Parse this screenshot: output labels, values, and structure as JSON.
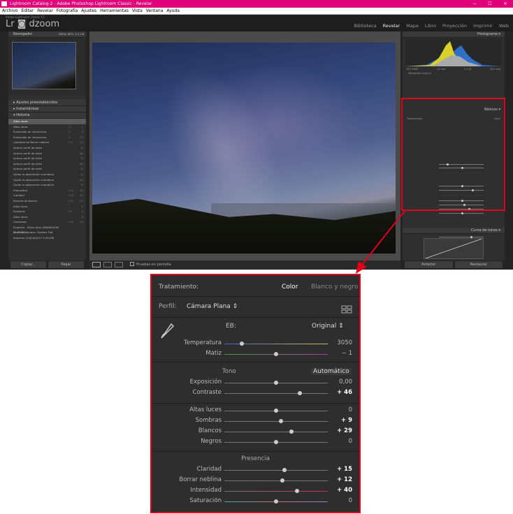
{
  "window": {
    "title": "Lightroom Catalog-2 - Adobe Photoshop Lightroom Classic - Revelar",
    "controls": [
      "—",
      "☐",
      "✕"
    ]
  },
  "menu": [
    "Archivo",
    "Editar",
    "Revelar",
    "Fotografía",
    "Ajustes",
    "Herramientas",
    "Vista",
    "Ventana",
    "Ayuda"
  ],
  "identity": {
    "sub": "Adobe Lightroom Classic CC",
    "logo": "Lr ◙ dzoom"
  },
  "modules": [
    "Biblioteca",
    "Revelar",
    "Mapa",
    "Libro",
    "Proyección",
    "Imprimir",
    "Web"
  ],
  "activeModule": "Revelar",
  "left": {
    "navigator": "Navegador",
    "nav_modes": "ENCAJ.  RELL.  1:1  1:8",
    "presets": "Ajustes preestablecidos",
    "snapshots": "Instantáneas",
    "history": "Historia",
    "history_items": [
      {
        "label": "Altas luces",
        "a": "-7",
        "b": "0",
        "sel": true
      },
      {
        "label": "Altas luces",
        "a": "-7",
        "b": "7"
      },
      {
        "label": "Suavizado de luminancia",
        "a": "-1",
        "b": "0"
      },
      {
        "label": "Suavizado de luminancia",
        "a": "-1",
        "b": "10"
      },
      {
        "label": "Cantidad de Borrar neblina",
        "a": "+11",
        "b": "12"
      },
      {
        "label": "Activar perfil de lente",
        "a": "",
        "b": "Sí"
      },
      {
        "label": "Activar perfil de lente",
        "a": "",
        "b": "No"
      },
      {
        "label": "Activar perfil de lente",
        "a": "",
        "b": "Sí"
      },
      {
        "label": "Activar perfil de lente",
        "a": "",
        "b": "No"
      },
      {
        "label": "Activar perfil de lente",
        "a": "",
        "b": "Sí"
      },
      {
        "label": "Quitar la aberración cromática",
        "a": "",
        "b": "Sí"
      },
      {
        "label": "Quitar la aberración cromática",
        "a": "",
        "b": "No"
      },
      {
        "label": "Quitar la aberración cromática",
        "a": "",
        "b": "Sí"
      },
      {
        "label": "Intensidad",
        "a": "+40",
        "b": "40"
      },
      {
        "label": "Claridad",
        "a": "+15",
        "b": "15"
      },
      {
        "label": "Recorte de blanco",
        "a": "+29",
        "b": "29"
      },
      {
        "label": "Altas luces",
        "a": "",
        "b": "0"
      },
      {
        "label": "Sombras",
        "a": "+9",
        "b": "9"
      },
      {
        "label": "Altas luces",
        "a": "",
        "b": "0"
      },
      {
        "label": "Contraste",
        "a": "+46",
        "b": "46"
      },
      {
        "label": "Exportar - Disco duro (28/06/2018 11:03:57)",
        "a": "",
        "b": ""
      },
      {
        "label": "Perfil de cámara: Camera Flat",
        "a": "",
        "b": ""
      },
      {
        "label": "Importar (24/04/2017 0:45:06)",
        "a": "",
        "b": ""
      }
    ],
    "copy": "Copiar...",
    "paste": "Pegar"
  },
  "toolbar": {
    "soft_proof": "Pruebas en pantalla"
  },
  "right": {
    "histogram": "Histograma",
    "exif": [
      "ISO 6400",
      "14 mm",
      "f / 2,8",
      "30,0 seg"
    ],
    "original_photo": "Fotografía original",
    "basics": "Básicos",
    "curve": "Curva de tonos",
    "previous": "Anterior",
    "reset": "Restaurar"
  },
  "basic": {
    "treatment": "Tratamiento:",
    "color": "Color",
    "bw": "Blanco y negro",
    "profile_label": "Perfil:",
    "profile": "Cámara Plana ⇕",
    "wb_label": "EB:",
    "wb": "Original ⇕",
    "tone": "Tono",
    "auto": "Automático",
    "presence": "Presencia",
    "sliders": [
      {
        "label": "Temperatura",
        "value": "3050",
        "pos": 0.17,
        "track": "temp",
        "group": "wb"
      },
      {
        "label": "Matiz",
        "value": "− 1",
        "pos": 0.5,
        "track": "tint",
        "group": "wb"
      },
      {
        "label": "Exposición",
        "value": "0,00",
        "pos": 0.5,
        "track": "",
        "group": "tone"
      },
      {
        "label": "Contraste",
        "value": "+ 46",
        "pos": 0.73,
        "track": "",
        "group": "tone",
        "bold": true
      },
      {
        "label": "Altas luces",
        "value": "0",
        "pos": 0.5,
        "track": "",
        "group": "tone2"
      },
      {
        "label": "Sombras",
        "value": "+ 9",
        "pos": 0.55,
        "track": "",
        "group": "tone2",
        "bold": true
      },
      {
        "label": "Blancos",
        "value": "+ 29",
        "pos": 0.65,
        "track": "",
        "group": "tone2",
        "bold": true
      },
      {
        "label": "Negros",
        "value": "0",
        "pos": 0.5,
        "track": "",
        "group": "tone2"
      },
      {
        "label": "Claridad",
        "value": "+ 15",
        "pos": 0.58,
        "track": "",
        "group": "pres",
        "bold": true
      },
      {
        "label": "Borrar neblina",
        "value": "+ 12",
        "pos": 0.56,
        "track": "",
        "group": "pres",
        "bold": true
      },
      {
        "label": "Intensidad",
        "value": "+ 40",
        "pos": 0.7,
        "track": "vib",
        "group": "pres",
        "bold": true
      },
      {
        "label": "Saturación",
        "value": "0",
        "pos": 0.5,
        "track": "sat",
        "group": "pres"
      }
    ]
  },
  "colors": {
    "titlebar": "#e0007a",
    "callout": "#e3001b"
  }
}
